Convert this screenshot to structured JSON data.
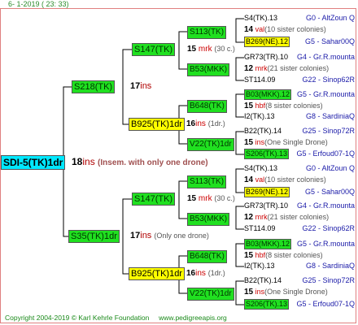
{
  "header": {
    "date": "6-  1-2019 ( 23: 33)"
  },
  "root": {
    "name": "SDI-5(TK)1dr",
    "gen": "18",
    "unit": "ins",
    "note": "(Insem. with only one drone)"
  },
  "father_sire": {
    "name": "S218(TK)",
    "gen": "17",
    "unit": "ins"
  },
  "mother_sire": {
    "name": "S35(TK)1dr",
    "gen": "17",
    "unit": "ins",
    "note": "(Only one drone)"
  },
  "blocks": [
    {
      "s147": {
        "name": "S147(TK)",
        "gen": "15",
        "unit": "mrk",
        "note": "(30 c.)"
      },
      "b925": {
        "name": "B925(TK)1dr",
        "gen": "16",
        "unit": "ins",
        "note": "(1dr.)"
      },
      "s113": {
        "name": "S113(TK)"
      },
      "b53": {
        "name": "B53(MKK)"
      },
      "b648": {
        "name": "B648(TK)"
      },
      "v22": {
        "name": "V22(TK)1dr"
      },
      "a1": {
        "name": "S4(TK).13",
        "code": "G0 - AltZoun Q"
      },
      "a1n": {
        "gen": "14",
        "unit": "val",
        "note": "(10 sister colonies)"
      },
      "a2": {
        "name": "B269(NE).12",
        "code": "G5 - Sahar00Q"
      },
      "a3": {
        "name": "GR73(TR).10",
        "code": "G4 - Gr.R.mounta"
      },
      "a3n": {
        "gen": "12",
        "unit": "mrk",
        "note": "(21 sister colonies)"
      },
      "a4": {
        "name": "ST114.09",
        "code": "G22 - Sinop62R"
      },
      "a5": {
        "name": "B03(MKK).12",
        "code": "G5 - Gr.R.mounta"
      },
      "a5n": {
        "gen": "15",
        "unit": "hbf",
        "note": "(8 sister colonies)"
      },
      "a6": {
        "name": "I2(TK).13",
        "code": "G8 - SardiniaQ"
      },
      "a7": {
        "name": "B22(TK).14",
        "code": "G25 - Sinop72R"
      },
      "a7n": {
        "gen": "15",
        "unit": "ins",
        "note": "(One Single Drone)"
      },
      "a8": {
        "name": "S206(TK).13",
        "code": "G5 - Erfoud07-1Q"
      }
    },
    {
      "s147": {
        "name": "S147(TK)",
        "gen": "15",
        "unit": "mrk",
        "note": "(30 c.)"
      },
      "b925": {
        "name": "B925(TK)1dr",
        "gen": "16",
        "unit": "ins",
        "note": "(1dr.)"
      },
      "s113": {
        "name": "S113(TK)"
      },
      "b53": {
        "name": "B53(MKK)"
      },
      "b648": {
        "name": "B648(TK)"
      },
      "v22": {
        "name": "V22(TK)1dr"
      },
      "a1": {
        "name": "S4(TK).13",
        "code": "G0 - AltZoun Q"
      },
      "a1n": {
        "gen": "14",
        "unit": "val",
        "note": "(10 sister colonies)"
      },
      "a2": {
        "name": "B269(NE).12",
        "code": "G5 - Sahar00Q"
      },
      "a3": {
        "name": "GR73(TR).10",
        "code": "G4 - Gr.R.mounta"
      },
      "a3n": {
        "gen": "12",
        "unit": "mrk",
        "note": "(21 sister colonies)"
      },
      "a4": {
        "name": "ST114.09",
        "code": "G22 - Sinop62R"
      },
      "a5": {
        "name": "B03(MKK).12",
        "code": "G5 - Gr.R.mounta"
      },
      "a5n": {
        "gen": "15",
        "unit": "hbf",
        "note": "(8 sister colonies)"
      },
      "a6": {
        "name": "I2(TK).13",
        "code": "G8 - SardiniaQ"
      },
      "a7": {
        "name": "B22(TK).14",
        "code": "G25 - Sinop72R"
      },
      "a7n": {
        "gen": "15",
        "unit": "ins",
        "note": "(One Single Drone)"
      },
      "a8": {
        "name": "S206(TK).13",
        "code": "G5 - Erfoud07-1Q"
      }
    }
  ],
  "footer": {
    "copyright": "Copyright 2004-2019 © Karl Kehrle Foundation",
    "url": "www.pedigreeapis.org"
  }
}
